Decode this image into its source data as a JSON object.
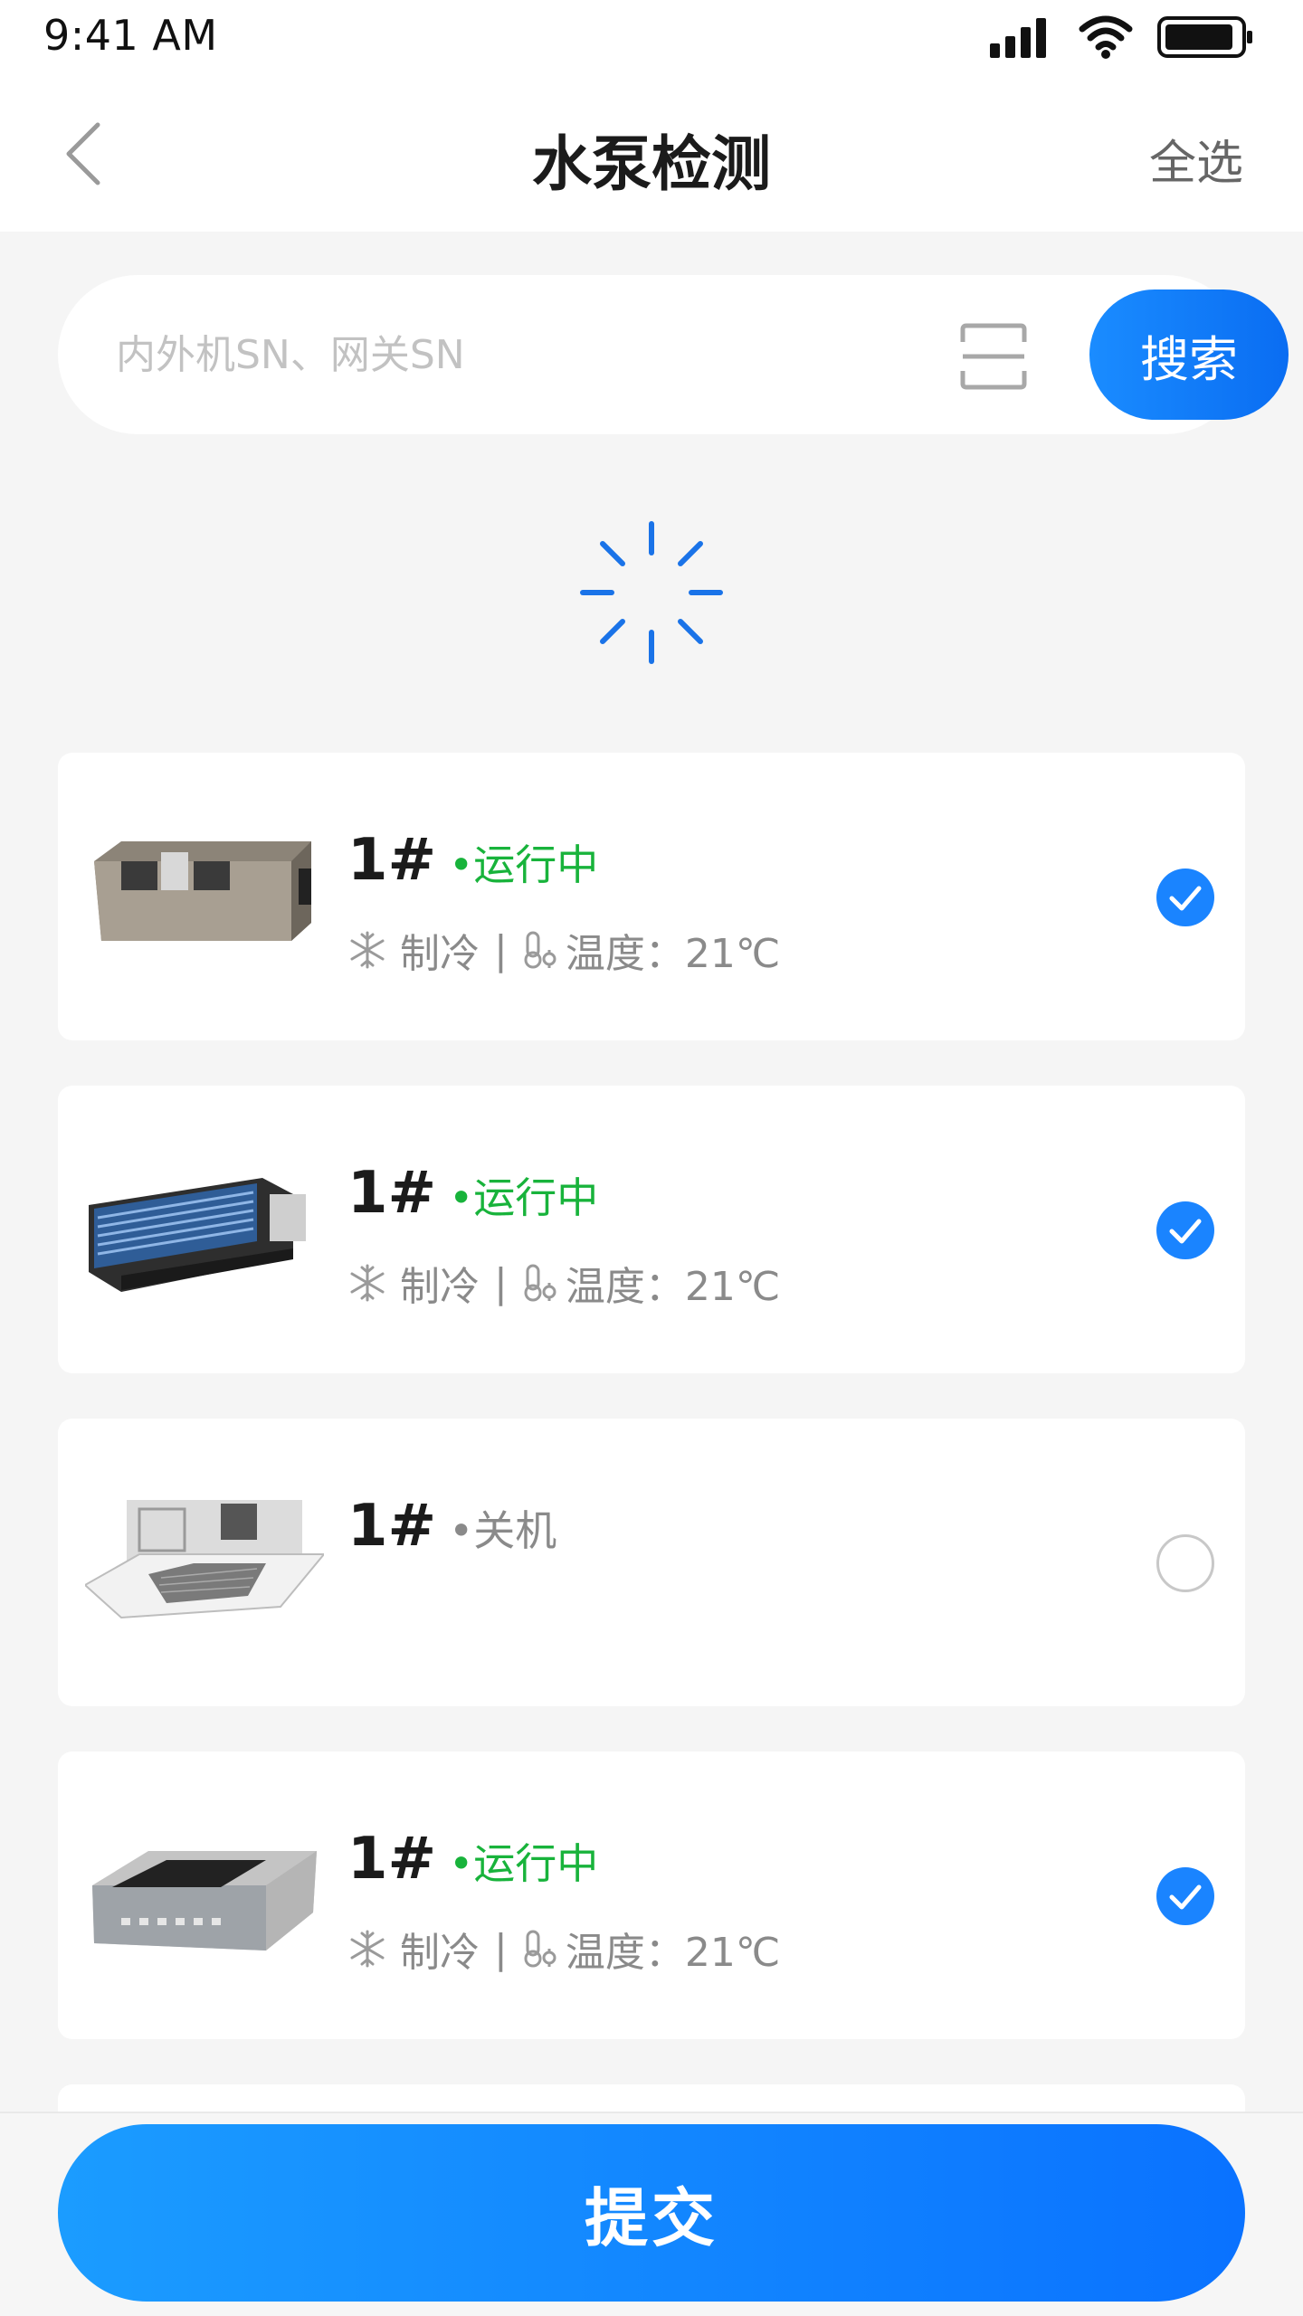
{
  "status_bar": {
    "time": "9:41 AM",
    "icons": [
      "signal-icon",
      "wifi-icon",
      "battery-icon"
    ]
  },
  "nav": {
    "back_icon": "chevron-left-icon",
    "title": "水泵检测",
    "select_all": "全选"
  },
  "search": {
    "placeholder": "内外机SN、网关SN",
    "value": "",
    "scan_icon": "scan-icon",
    "button_label": "搜索"
  },
  "loading": {
    "icon": "spinner-icon"
  },
  "devices": [
    {
      "name": "1#",
      "status": "•运行中",
      "running": true,
      "mode_icon": "snowflake-icon",
      "mode": "制冷",
      "separator": "|",
      "temp_icon": "thermometer-icon",
      "temperature": "温度：21℃",
      "selected": true
    },
    {
      "name": "1#",
      "status": "•运行中",
      "running": true,
      "mode_icon": "snowflake-icon",
      "mode": "制冷",
      "separator": "|",
      "temp_icon": "thermometer-icon",
      "temperature": "温度：21℃",
      "selected": true
    },
    {
      "name": "1#",
      "status": "•关机",
      "running": false,
      "selected": false
    },
    {
      "name": "1#",
      "status": "•运行中",
      "running": true,
      "mode_icon": "snowflake-icon",
      "mode": "制冷",
      "separator": "|",
      "temp_icon": "thermometer-icon",
      "temperature": "温度：21℃",
      "selected": true
    }
  ],
  "submit": {
    "label": "提交"
  },
  "colors": {
    "accent": "#1a84ff",
    "running": "#18b33b",
    "off": "#8a8a8a",
    "background": "#f5f5f5"
  }
}
